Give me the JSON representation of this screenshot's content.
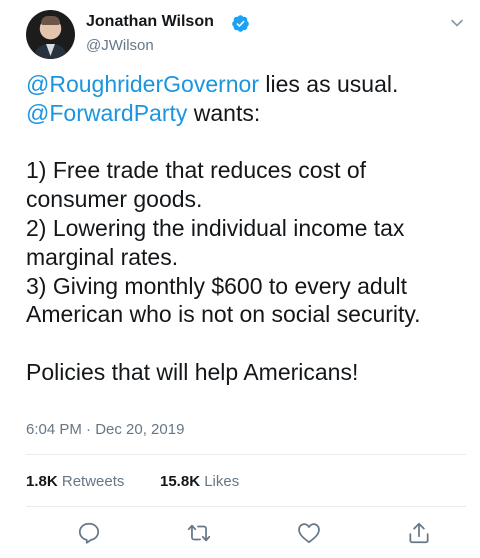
{
  "author": {
    "display_name": "Jonathan Wilson",
    "handle": "@JWilson",
    "verified": true,
    "avatar_icon": "avatar-photo",
    "caret_icon": "chevron-down-icon"
  },
  "tweet": {
    "line1_mention": "@RoughriderGovernor",
    "line1_rest": " lies as usual.",
    "line2_mention": "@ForwardParty",
    "line2_rest": " wants:",
    "item1_a": "1) Free trade that reduces cost of",
    "item1_b": "consumer goods.",
    "item2_a": "2) Lowering the individual income tax",
    "item2_b": "marginal rates.",
    "item3_a": "3) Giving monthly $600 to every adult",
    "item3_b": "American who is not on social security.",
    "closing": "Policies that will help Americans!",
    "timestamp": "6:04 PM · Dec 20, 2019"
  },
  "stats": {
    "retweets_count": "1.8K",
    "retweets_label": "Retweets",
    "likes_count": "15.8K",
    "likes_label": "Likes"
  },
  "actions": [
    {
      "icon": "reply-icon"
    },
    {
      "icon": "retweet-icon"
    },
    {
      "icon": "like-icon"
    },
    {
      "icon": "share-icon"
    }
  ],
  "colors": {
    "accent": "#1b95e0",
    "verified_badge": "#1da1f2",
    "text_primary": "#14171a",
    "text_secondary": "#657786",
    "divider": "#e6ecf0"
  }
}
